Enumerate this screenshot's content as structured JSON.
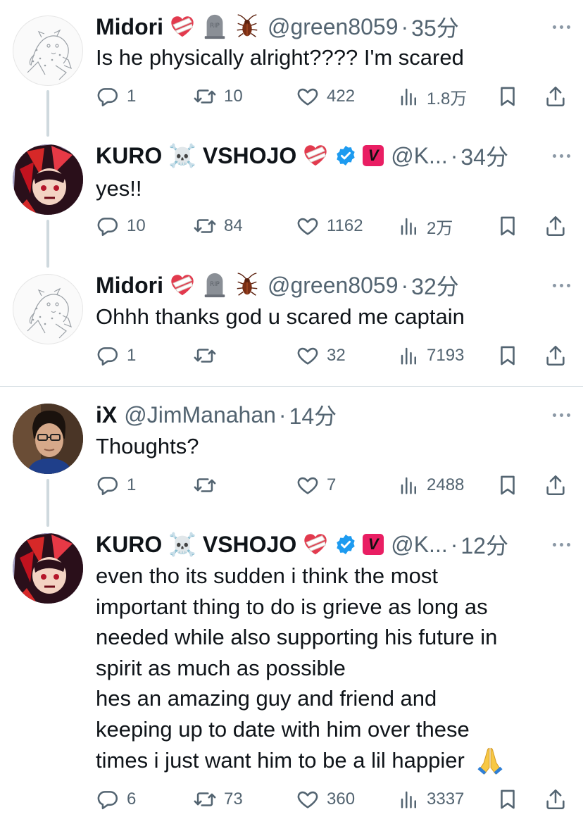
{
  "colors": {
    "text": "#0f1419",
    "secondary": "#536471",
    "thread_line": "#cfd9de",
    "verified": "#1d9bf0",
    "vshojo_badge": "#e91e63"
  },
  "tweets": [
    {
      "name": "Midori",
      "handle": "@green8059",
      "dot": "·",
      "time": "35分",
      "text": "Is he physically alright???? I'm scared",
      "replies": "1",
      "retweets": "10",
      "likes": "422",
      "views": "1.8万",
      "badges": [
        "mending-heart-emoji",
        "headstone-emoji",
        "cockroach-emoji"
      ]
    },
    {
      "name": "KURO ☠️ VSHOJO",
      "handle": "@K...",
      "dot": "·",
      "time": "34分",
      "text": "yes!!",
      "replies": "10",
      "retweets": "84",
      "likes": "1162",
      "views": "2万",
      "badges": [
        "mending-heart-emoji",
        "verified-icon",
        "vshojo-badge"
      ]
    },
    {
      "name": "Midori",
      "handle": "@green8059",
      "dot": "·",
      "time": "32分",
      "text": "Ohhh thanks god u scared me captain",
      "replies": "1",
      "retweets": "",
      "likes": "32",
      "views": "7193",
      "badges": [
        "mending-heart-emoji",
        "headstone-emoji",
        "cockroach-emoji"
      ]
    },
    {
      "name": "iX",
      "handle": "@JimManahan",
      "dot": "·",
      "time": "14分",
      "text": "Thoughts?",
      "replies": "1",
      "retweets": "",
      "likes": "7",
      "views": "2488",
      "badges": []
    },
    {
      "name": "KURO ☠️ VSHOJO",
      "handle": "@K...",
      "dot": "·",
      "time": "12分",
      "text_lines": [
        "even tho its sudden i think the most",
        "important thing to do is grieve as long as",
        "needed while also supporting his future in",
        "spirit as much as possible",
        "hes an amazing guy and friend and",
        "keeping up to date with him over these",
        "times i just want him to be a lil happier"
      ],
      "replies": "6",
      "retweets": "73",
      "likes": "360",
      "views": "3337",
      "badges": [
        "mending-heart-emoji",
        "verified-icon",
        "vshojo-badge"
      ],
      "trailing_emoji": "folded-hands-emoji"
    }
  ],
  "vshojo_badge_letter": "V"
}
